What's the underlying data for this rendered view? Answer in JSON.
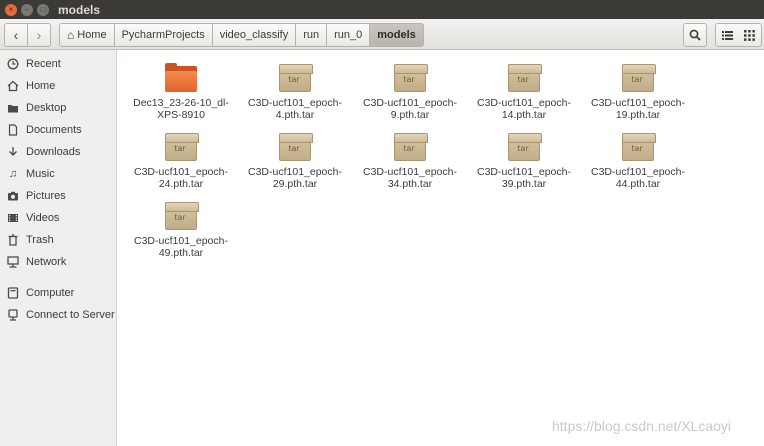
{
  "window": {
    "title": "models",
    "buttons": [
      "×",
      "–",
      "□"
    ]
  },
  "toolbar": {
    "back": "‹",
    "forward": "›",
    "breadcrumbs": [
      {
        "label": "Home",
        "icon": "home-icon"
      },
      {
        "label": "PycharmProjects"
      },
      {
        "label": "video_classify"
      },
      {
        "label": "run"
      },
      {
        "label": "run_0"
      },
      {
        "label": "models",
        "active": true
      }
    ],
    "search_icon": "search-icon",
    "list_view_icon": "list-view-icon",
    "grid_view_icon": "grid-view-icon"
  },
  "sidebar": {
    "items": [
      {
        "label": "Recent",
        "icon": "recent-icon"
      },
      {
        "label": "Home",
        "icon": "home-icon"
      },
      {
        "label": "Desktop",
        "icon": "desktop-icon"
      },
      {
        "label": "Documents",
        "icon": "documents-icon"
      },
      {
        "label": "Downloads",
        "icon": "downloads-icon"
      },
      {
        "label": "Music",
        "icon": "music-icon"
      },
      {
        "label": "Pictures",
        "icon": "pictures-icon"
      },
      {
        "label": "Videos",
        "icon": "videos-icon"
      },
      {
        "label": "Trash",
        "icon": "trash-icon"
      },
      {
        "label": "Network",
        "icon": "network-icon"
      },
      {
        "label": "Computer",
        "icon": "computer-icon"
      },
      {
        "label": "Connect to Server",
        "icon": "connect-server-icon"
      }
    ]
  },
  "files": [
    {
      "name": "Dec13_23-26-10_dl-XPS-8910",
      "type": "folder"
    },
    {
      "name": "C3D-ucf101_epoch-4.pth.tar",
      "type": "tar"
    },
    {
      "name": "C3D-ucf101_epoch-9.pth.tar",
      "type": "tar"
    },
    {
      "name": "C3D-ucf101_epoch-14.pth.tar",
      "type": "tar"
    },
    {
      "name": "C3D-ucf101_epoch-19.pth.tar",
      "type": "tar"
    },
    {
      "name": "C3D-ucf101_epoch-24.pth.tar",
      "type": "tar"
    },
    {
      "name": "C3D-ucf101_epoch-29.pth.tar",
      "type": "tar"
    },
    {
      "name": "C3D-ucf101_epoch-34.pth.tar",
      "type": "tar"
    },
    {
      "name": "C3D-ucf101_epoch-39.pth.tar",
      "type": "tar"
    },
    {
      "name": "C3D-ucf101_epoch-44.pth.tar",
      "type": "tar"
    },
    {
      "name": "C3D-ucf101_epoch-49.pth.tar",
      "type": "tar"
    }
  ],
  "tar_icon_label": "tar",
  "watermark": "https://blog.csdn.net/XLcaoyi"
}
